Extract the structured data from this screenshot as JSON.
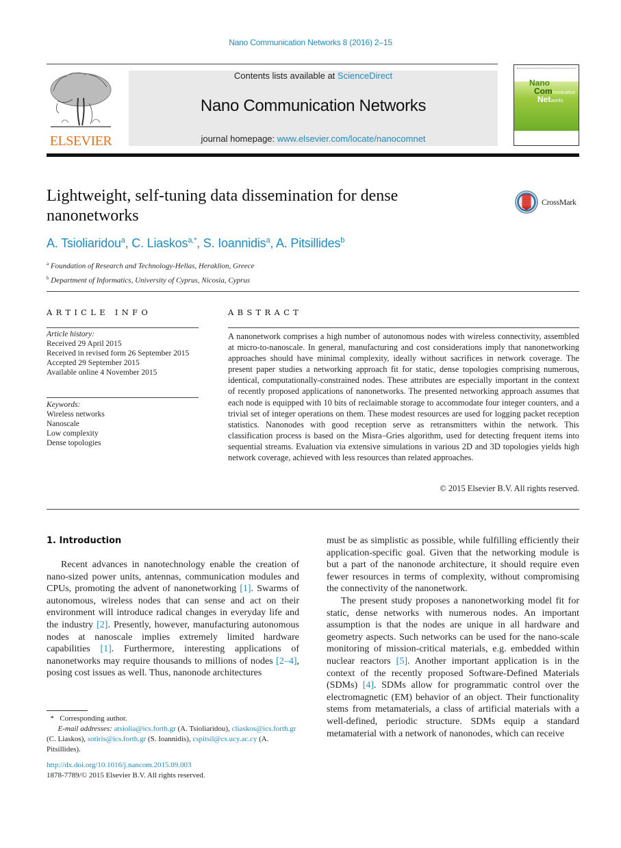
{
  "header": {
    "journal_ref": "Nano Communication Networks 8 (2016) 2–15",
    "contents_prefix": "Contents lists available at ",
    "contents_link": "ScienceDirect",
    "journal_name": "Nano Communication Networks",
    "homepage_prefix": "journal homepage: ",
    "homepage_link": "www.elsevier.com/locate/nanocomnet",
    "publisher_logo_text": "ELSEVIER",
    "cover": {
      "line1": "Nano",
      "line2_big": "Com",
      "line2_small": "munication",
      "line3_big": "Net",
      "line3_small": "works"
    },
    "colors": {
      "link": "#1f8ac0",
      "elsevier_orange": "#e9711c",
      "header_box": "#e9e9e9",
      "cover_green": "#9cc93e"
    }
  },
  "article": {
    "title": "Lightweight, self-tuning data dissemination for dense nanonetworks",
    "crossmark_label": "CrossMark",
    "authors": [
      {
        "name": "A. Tsioliaridou",
        "sup": "a"
      },
      {
        "name": "C. Liaskos",
        "sup": "a,*"
      },
      {
        "name": "S. Ioannidis",
        "sup": "a"
      },
      {
        "name": "A. Pitsillides",
        "sup": "b"
      }
    ],
    "affiliations": [
      {
        "sup": "a",
        "text": "Foundation of Research and Technology-Hellas, Heraklion, Greece"
      },
      {
        "sup": "b",
        "text": "Department of Informatics, University of Cyprus, Nicosia, Cyprus"
      }
    ]
  },
  "article_info": {
    "heading": "ARTICLE INFO",
    "history_label": "Article history:",
    "history": [
      "Received 29 April 2015",
      "Received in revised form 26 September 2015",
      "Accepted 29 September 2015",
      "Available online 4 November 2015"
    ],
    "keywords_label": "Keywords:",
    "keywords": [
      "Wireless networks",
      "Nanoscale",
      "Low complexity",
      "Dense topologies"
    ]
  },
  "abstract": {
    "heading": "ABSTRACT",
    "text": "A nanonetwork comprises a high number of autonomous nodes with wireless connectivity, assembled at micro-to-nanoscale. In general, manufacturing and cost considerations imply that nanonetworking approaches should have minimal complexity, ideally without sacrifices in network coverage. The present paper studies a networking approach fit for static, dense topologies comprising numerous, identical, computationally-constrained nodes. These attributes are especially important in the context of recently proposed applications of nanonetworks. The presented networking approach assumes that each node is equipped with 10 bits of reclaimable storage to accommodate four integer counters, and a trivial set of integer operations on them. These modest resources are used for logging packet reception statistics. Nanonodes with good reception serve as retransmitters within the network. This classification process is based on the Misra–Gries algorithm, used for detecting frequent items into sequential streams. Evaluation via extensive simulations in various 2D and 3D topologies yields high network coverage, achieved with less resources than related approaches.",
    "copyright": "© 2015 Elsevier B.V. All rights reserved."
  },
  "body": {
    "section_heading": "1.  Introduction",
    "left_col": {
      "p1_a": "Recent advances in nanotechnology enable the creation of nano-sized power units, antennas, communication modules and CPUs, promoting the advent of nanonetworking ",
      "ref1": "[1]",
      "p1_b": ". Swarms of autonomous, wireless nodes that can sense and act on their environment will introduce radical changes in everyday life and the industry ",
      "ref2": "[2]",
      "p1_c": ". Presently, however, manufacturing autonomous nodes at nanoscale implies extremely limited hardware capabilities ",
      "ref3": "[1]",
      "p1_d": ". Furthermore, interesting applications of nanonetworks may require thousands to millions of nodes ",
      "ref4": "[2–4]",
      "p1_e": ", posing cost issues as well. Thus, nanonode architectures"
    },
    "right_col": {
      "p1": "must be as simplistic as possible, while fulfilling efficiently their application-specific goal. Given that the networking module is but a part of the nanonode architecture, it should require even fewer resources in terms of complexity, without compromising the connectivity of the nanonetwork.",
      "p2_a": "The present study proposes a nanonetworking model fit for static, dense networks with numerous nodes. An important assumption is that the nodes are unique in all hardware and geometry aspects. Such networks can be used for the nano-scale monitoring of mission-critical materials, e.g. embedded within nuclear reactors ",
      "ref5": "[5]",
      "p2_b": ". Another important application is in the context of the recently proposed Software-Defined Materials (SDMs) ",
      "ref6": "[4]",
      "p2_c": ". SDMs allow for programmatic control over the electromagnetic (EM) behavior of an object. Their functionality stems from metamaterials, a class of artificial materials with a well-defined, periodic structure. SDMs equip a standard metamaterial with a network of nanonodes, which can receive"
    }
  },
  "footnotes": {
    "star": "*",
    "corresponding": "Corresponding author.",
    "email_label": "E-mail addresses:",
    "emails": [
      {
        "email": "atsiolia@ics.forth.gr",
        "name": "(A. Tsioliaridou),"
      },
      {
        "email": "cliaskos@ics.forth.gr",
        "name": "(C. Liaskos),"
      },
      {
        "email": "sotiris@ics.forth.gr",
        "name": "(S. Ioannidis),"
      },
      {
        "email": "cspitsil@cs.ucy.ac.cy",
        "name": "(A. Pitsillides)."
      }
    ],
    "doi": "http://dx.doi.org/10.1016/j.nancom.2015.09.003",
    "issn_copyright": "1878-7789/© 2015 Elsevier B.V. All rights reserved."
  }
}
